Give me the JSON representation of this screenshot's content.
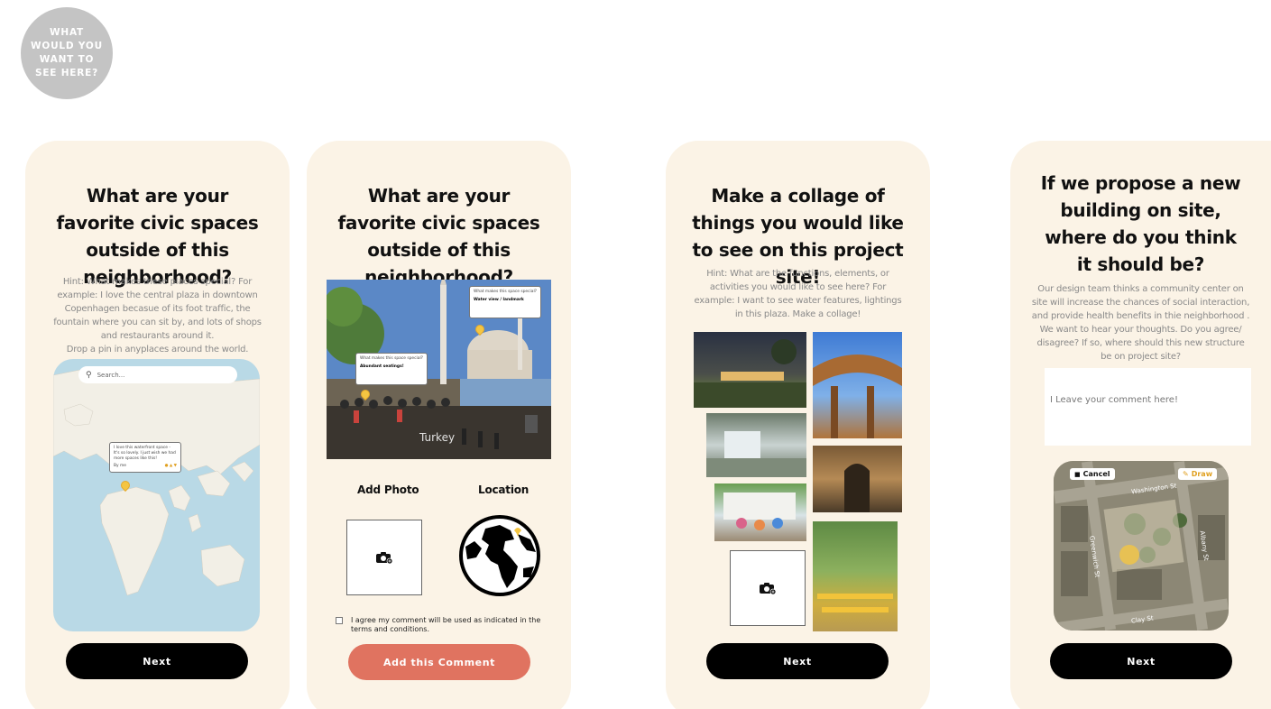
{
  "badge": "WHAT WOULD YOU WANT TO SEE HERE?",
  "card1": {
    "title": "What are your favorite civic spaces outside of this neighborhood?",
    "hint": "Hint: What makes these places special? For example: I love the central plaza in downtown Copenhagen becasue of its foot traffic, the fountain where you can sit by, and lots of shops and restaurants around it.",
    "hint2": "Drop a pin  in anyplaces around the world.",
    "search_placeholder": "Search...",
    "tooltip": "I love this waterfront space - It's so lovely. I just wish we had more spaces like this!",
    "tooltip_meta": "By me",
    "button": "Next"
  },
  "card2": {
    "title": "What are your favorite civic spaces outside of this neighborhood?",
    "photo_caption": "Turkey",
    "bubble1_q": "What makes this space special?",
    "bubble1_a": "Water view / landmark",
    "bubble2_q": "What makes this space special?",
    "bubble2_a": "Abundant seatings!",
    "add_photo": "Add Photo",
    "location": "Location",
    "agree": "I agree my comment will be used as indicated in the terms and conditions.",
    "button": "Add this Comment"
  },
  "card3": {
    "title": "Make a collage of things you would like to see on this project site!",
    "hint": "Hint: What are the functions, elements, or activities you would like to see here? For example: I want to see water features, lightings in this plaza. Make a collage!",
    "button": "Next"
  },
  "card4": {
    "title": "If we propose a new building on site, where do you think it should be?",
    "hint": "Our design team thinks a community center on site will increase the chances of social interaction, and provide health benefits in thie neighborhood . We want to hear your thoughts. Do you agree/ disagree? If so, where should this new structure be on project site?",
    "comment_placeholder": "I Leave your comment here!",
    "cancel": "Cancel",
    "draw": "Draw",
    "street1": "Washington St",
    "street2": "Albany St",
    "street3": "Greenwich St",
    "street4": "Clay St",
    "button": "Next"
  },
  "colors": {
    "card_bg": "#fbf3e6",
    "coral": "#e07360",
    "badge": "#c4c4c4",
    "ocean": "#b9d9e6",
    "land": "#f2efe6"
  }
}
